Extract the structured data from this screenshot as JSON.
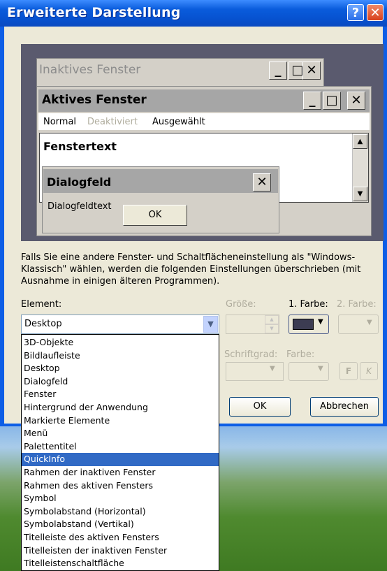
{
  "window": {
    "title": "Erweiterte Darstellung",
    "help_label": "?",
    "close_label": "✕"
  },
  "preview": {
    "inactive_title": "Inaktives Fenster",
    "active_title": "Aktives Fenster",
    "menu_normal": "Normal",
    "menu_disabled": "Deaktiviert",
    "menu_selected": "Ausgewählt",
    "window_text": "Fenstertext",
    "dialog_title": "Dialogfeld",
    "dialog_text": "Dialogfeldtext",
    "ok_label": "OK",
    "minimize": "_",
    "maximize": "□",
    "close": "✕"
  },
  "info_text": "Falls Sie eine andere Fenster- und Schaltflächeneinstellung als \"Windows-Klassisch\" wählen, werden die folgenden Einstellungen überschrieben (mit Ausnahme in einigen älteren Programmen).",
  "labels": {
    "element": "Element:",
    "size": "Größe:",
    "color1": "1. Farbe:",
    "color2": "2. Farbe:",
    "font_size": "Schriftgrad:",
    "font_color": "Farbe:"
  },
  "element_select_value": "Desktop",
  "format_buttons": {
    "bold": "F",
    "italic": "K"
  },
  "buttons": {
    "ok": "OK",
    "cancel": "Abbrechen"
  },
  "colors": {
    "color1": "#3c3c52",
    "selection": "#316ac5",
    "titlebar": "#0a5cdc"
  },
  "dropdown_items": [
    "3D-Objekte",
    "Bildlaufleiste",
    "Desktop",
    "Dialogfeld",
    "Fenster",
    "Hintergrund der Anwendung",
    "Markierte Elemente",
    "Menü",
    "Palettentitel",
    "QuickInfo",
    "Rahmen der inaktiven Fenster",
    "Rahmen des aktiven Fensters",
    "Symbol",
    "Symbolabstand (Horizontal)",
    "Symbolabstand (Vertikal)",
    "Titelleiste des aktiven Fensters",
    "Titelleisten der inaktiven Fenster",
    "Titelleistenschaltfläche"
  ],
  "dropdown_selected_index": 9
}
